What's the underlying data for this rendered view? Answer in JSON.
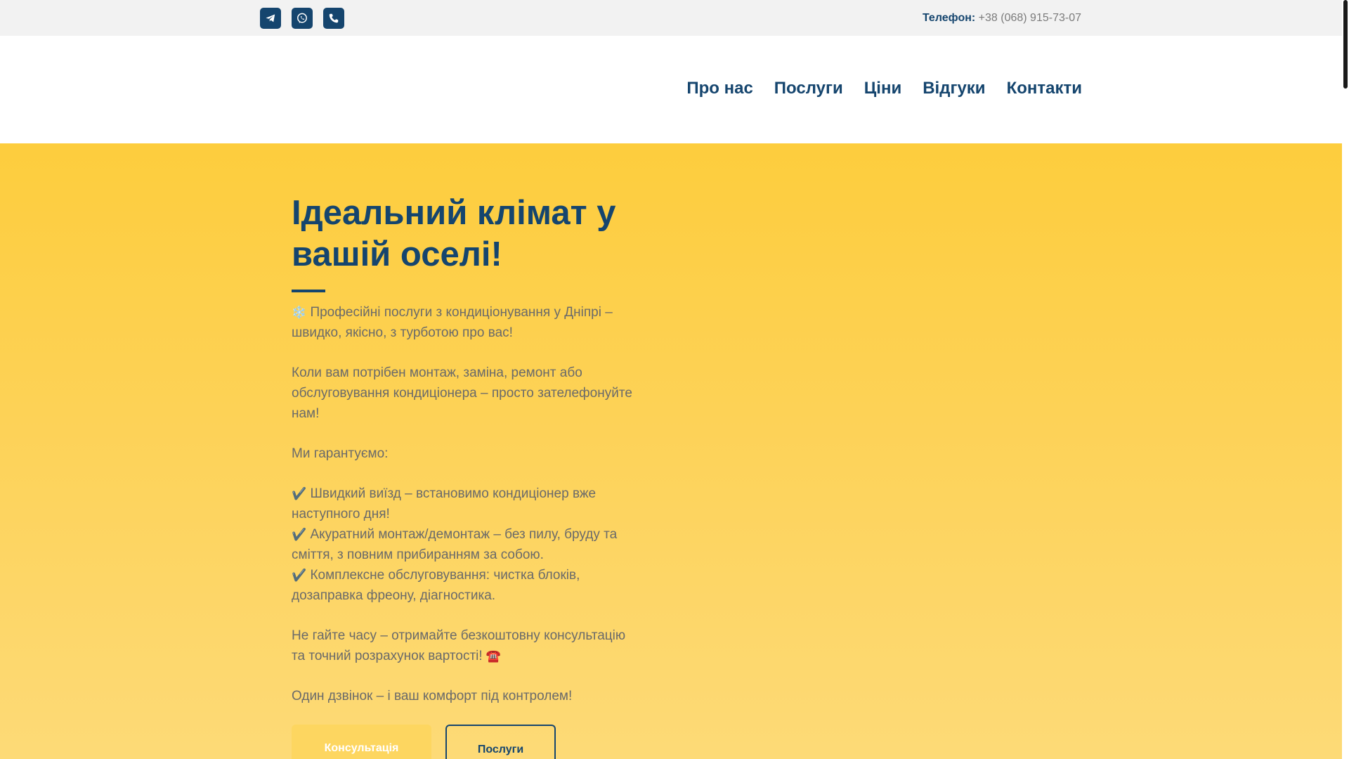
{
  "topbar": {
    "socials": [
      {
        "name": "telegram-icon",
        "label": "Telegram"
      },
      {
        "name": "viber-icon",
        "label": "Viber"
      },
      {
        "name": "phone-icon",
        "label": "Phone"
      }
    ],
    "phone_label": "Телефон:",
    "phone_number": "+38 (068) 915-73-07"
  },
  "nav": {
    "items": [
      {
        "label": "Про нас"
      },
      {
        "label": "Послуги"
      },
      {
        "label": "Ціни"
      },
      {
        "label": "Відгуки"
      },
      {
        "label": "Контакти"
      }
    ]
  },
  "hero": {
    "title_line1": "Ідеальний клімат у",
    "title_line2": "вашій оселі!",
    "intro_emoji": "❄️",
    "intro": "Професійні послуги з кондиціонування у Дніпрі – швидко, якісно, з турботою про вас!",
    "paragraph2": "Коли вам потрібен монтаж, заміна, ремонт або обслуговування кондиціонера – просто зателефонуйте нам!",
    "guarantee_heading": "Ми гарантуємо:",
    "check_emoji": "✔️",
    "bullets": [
      "Швидкий виїзд – встановимо кондиціонер вже наступного дня!",
      "Акуратний монтаж/демонтаж – без пилу, бруду та сміття, з повним прибиранням за собою.",
      "Комплексне обслуговування: чистка блоків, дозаправка фреону, діагностика."
    ],
    "cta_text": "Не гайте часу – отримайте безкоштовну консультацію та точний розрахунок вартості!",
    "cta_emoji": "☎️",
    "closing": "Один дзвінок – і ваш комфорт під контролем!",
    "buttons": {
      "consult": "Консультація",
      "services": "Послуги"
    }
  },
  "colors": {
    "brand_blue": "#15456e",
    "hero_yellow": "#fdcd3d",
    "topbar_bg": "#f2f2f2"
  }
}
